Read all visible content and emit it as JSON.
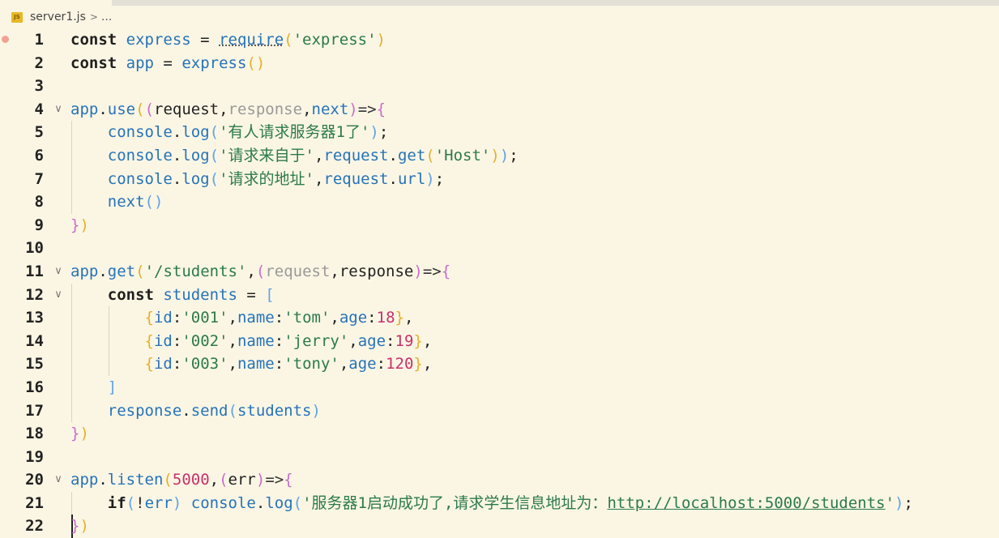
{
  "breadcrumb": {
    "file_icon": "js-file-icon",
    "file_icon_text": "JS",
    "file_name": "server1.js",
    "separator": ">",
    "more": "..."
  },
  "lines": [
    {
      "n": "1",
      "fold": false,
      "tokens": [
        [
          "kw",
          "const"
        ],
        [
          "plain",
          " "
        ],
        [
          "id",
          "express"
        ],
        [
          "plain",
          " = "
        ],
        [
          "id squig",
          "require"
        ],
        [
          "br1",
          "("
        ],
        [
          "str",
          "'express'"
        ],
        [
          "br1",
          ")"
        ]
      ]
    },
    {
      "n": "2",
      "fold": false,
      "tokens": [
        [
          "kw",
          "const"
        ],
        [
          "plain",
          " "
        ],
        [
          "id",
          "app"
        ],
        [
          "plain",
          " = "
        ],
        [
          "id",
          "express"
        ],
        [
          "br1",
          "()"
        ]
      ]
    },
    {
      "n": "3",
      "fold": false,
      "tokens": []
    },
    {
      "n": "4",
      "fold": true,
      "tokens": [
        [
          "id",
          "app"
        ],
        [
          "plain",
          "."
        ],
        [
          "id",
          "use"
        ],
        [
          "br1",
          "("
        ],
        [
          "br2",
          "("
        ],
        [
          "plain",
          "request"
        ],
        [
          "plain",
          ","
        ],
        [
          "par",
          "response"
        ],
        [
          "plain",
          ","
        ],
        [
          "id",
          "next"
        ],
        [
          "br2",
          ")"
        ],
        [
          "op",
          "=>"
        ],
        [
          "br2",
          "{"
        ]
      ]
    },
    {
      "n": "5",
      "fold": false,
      "tokens": [
        [
          "plain",
          "    "
        ],
        [
          "id",
          "console"
        ],
        [
          "plain",
          "."
        ],
        [
          "id",
          "log"
        ],
        [
          "br3",
          "("
        ],
        [
          "str",
          "'有人请求服务器1了'"
        ],
        [
          "br3",
          ")"
        ],
        [
          "plain",
          ";"
        ]
      ]
    },
    {
      "n": "6",
      "fold": false,
      "tokens": [
        [
          "plain",
          "    "
        ],
        [
          "id",
          "console"
        ],
        [
          "plain",
          "."
        ],
        [
          "id",
          "log"
        ],
        [
          "br3",
          "("
        ],
        [
          "str",
          "'请求来自于'"
        ],
        [
          "plain",
          ","
        ],
        [
          "id",
          "request"
        ],
        [
          "plain",
          "."
        ],
        [
          "id",
          "get"
        ],
        [
          "br1",
          "("
        ],
        [
          "str",
          "'Host'"
        ],
        [
          "br1",
          ")"
        ],
        [
          "br3",
          ")"
        ],
        [
          "plain",
          ";"
        ]
      ]
    },
    {
      "n": "7",
      "fold": false,
      "tokens": [
        [
          "plain",
          "    "
        ],
        [
          "id",
          "console"
        ],
        [
          "plain",
          "."
        ],
        [
          "id",
          "log"
        ],
        [
          "br3",
          "("
        ],
        [
          "str",
          "'请求的地址'"
        ],
        [
          "plain",
          ","
        ],
        [
          "id",
          "request"
        ],
        [
          "plain",
          "."
        ],
        [
          "id",
          "url"
        ],
        [
          "br3",
          ")"
        ],
        [
          "plain",
          ";"
        ]
      ]
    },
    {
      "n": "8",
      "fold": false,
      "tokens": [
        [
          "plain",
          "    "
        ],
        [
          "id",
          "next"
        ],
        [
          "br3",
          "()"
        ]
      ]
    },
    {
      "n": "9",
      "fold": false,
      "tokens": [
        [
          "br2",
          "}"
        ],
        [
          "br1",
          ")"
        ]
      ]
    },
    {
      "n": "10",
      "fold": false,
      "tokens": []
    },
    {
      "n": "11",
      "fold": true,
      "tokens": [
        [
          "id",
          "app"
        ],
        [
          "plain",
          "."
        ],
        [
          "id",
          "get"
        ],
        [
          "br1",
          "("
        ],
        [
          "str",
          "'/students'"
        ],
        [
          "plain",
          ","
        ],
        [
          "br2",
          "("
        ],
        [
          "par",
          "request"
        ],
        [
          "plain",
          ","
        ],
        [
          "plain",
          "response"
        ],
        [
          "br2",
          ")"
        ],
        [
          "op",
          "=>"
        ],
        [
          "br2",
          "{"
        ]
      ]
    },
    {
      "n": "12",
      "fold": true,
      "tokens": [
        [
          "plain",
          "    "
        ],
        [
          "kw",
          "const"
        ],
        [
          "plain",
          " "
        ],
        [
          "id",
          "students"
        ],
        [
          "plain",
          " = "
        ],
        [
          "br3",
          "["
        ]
      ]
    },
    {
      "n": "13",
      "fold": false,
      "tokens": [
        [
          "plain",
          "        "
        ],
        [
          "br1",
          "{"
        ],
        [
          "id",
          "id"
        ],
        [
          "plain",
          ":"
        ],
        [
          "str",
          "'001'"
        ],
        [
          "plain",
          ","
        ],
        [
          "id",
          "name"
        ],
        [
          "plain",
          ":"
        ],
        [
          "str",
          "'tom'"
        ],
        [
          "plain",
          ","
        ],
        [
          "id",
          "age"
        ],
        [
          "plain",
          ":"
        ],
        [
          "num",
          "18"
        ],
        [
          "br1",
          "}"
        ],
        [
          "plain",
          ","
        ]
      ]
    },
    {
      "n": "14",
      "fold": false,
      "tokens": [
        [
          "plain",
          "        "
        ],
        [
          "br1",
          "{"
        ],
        [
          "id",
          "id"
        ],
        [
          "plain",
          ":"
        ],
        [
          "str",
          "'002'"
        ],
        [
          "plain",
          ","
        ],
        [
          "id",
          "name"
        ],
        [
          "plain",
          ":"
        ],
        [
          "str",
          "'jerry'"
        ],
        [
          "plain",
          ","
        ],
        [
          "id",
          "age"
        ],
        [
          "plain",
          ":"
        ],
        [
          "num",
          "19"
        ],
        [
          "br1",
          "}"
        ],
        [
          "plain",
          ","
        ]
      ]
    },
    {
      "n": "15",
      "fold": false,
      "tokens": [
        [
          "plain",
          "        "
        ],
        [
          "br1",
          "{"
        ],
        [
          "id",
          "id"
        ],
        [
          "plain",
          ":"
        ],
        [
          "str",
          "'003'"
        ],
        [
          "plain",
          ","
        ],
        [
          "id",
          "name"
        ],
        [
          "plain",
          ":"
        ],
        [
          "str",
          "'tony'"
        ],
        [
          "plain",
          ","
        ],
        [
          "id",
          "age"
        ],
        [
          "plain",
          ":"
        ],
        [
          "num",
          "120"
        ],
        [
          "br1",
          "}"
        ],
        [
          "plain",
          ","
        ]
      ]
    },
    {
      "n": "16",
      "fold": false,
      "tokens": [
        [
          "plain",
          "    "
        ],
        [
          "br3",
          "]"
        ]
      ]
    },
    {
      "n": "17",
      "fold": false,
      "tokens": [
        [
          "plain",
          "    "
        ],
        [
          "id",
          "response"
        ],
        [
          "plain",
          "."
        ],
        [
          "id",
          "send"
        ],
        [
          "br3",
          "("
        ],
        [
          "id",
          "students"
        ],
        [
          "br3",
          ")"
        ]
      ]
    },
    {
      "n": "18",
      "fold": false,
      "tokens": [
        [
          "br2",
          "}"
        ],
        [
          "br1",
          ")"
        ]
      ]
    },
    {
      "n": "19",
      "fold": false,
      "tokens": []
    },
    {
      "n": "20",
      "fold": true,
      "tokens": [
        [
          "id",
          "app"
        ],
        [
          "plain",
          "."
        ],
        [
          "id",
          "listen"
        ],
        [
          "br1",
          "("
        ],
        [
          "num",
          "5000"
        ],
        [
          "plain",
          ","
        ],
        [
          "br2",
          "("
        ],
        [
          "plain",
          "err"
        ],
        [
          "br2",
          ")"
        ],
        [
          "op",
          "=>"
        ],
        [
          "br2",
          "{"
        ]
      ]
    },
    {
      "n": "21",
      "fold": false,
      "tokens": [
        [
          "plain",
          "    "
        ],
        [
          "kw",
          "if"
        ],
        [
          "br3",
          "("
        ],
        [
          "plain",
          "!"
        ],
        [
          "id",
          "err"
        ],
        [
          "br3",
          ")"
        ],
        [
          "plain",
          " "
        ],
        [
          "id",
          "console"
        ],
        [
          "plain",
          "."
        ],
        [
          "id",
          "log"
        ],
        [
          "br3",
          "("
        ],
        [
          "str",
          "'服务器1启动成功了,请求学生信息地址为："
        ],
        [
          "link",
          "http://localhost:5000/students"
        ],
        [
          "str",
          "'"
        ],
        [
          "br3",
          ")"
        ],
        [
          "plain",
          ";"
        ]
      ]
    },
    {
      "n": "22",
      "fold": false,
      "tokens": [
        [
          "br2",
          "}"
        ],
        [
          "br1",
          ")"
        ]
      ]
    }
  ]
}
